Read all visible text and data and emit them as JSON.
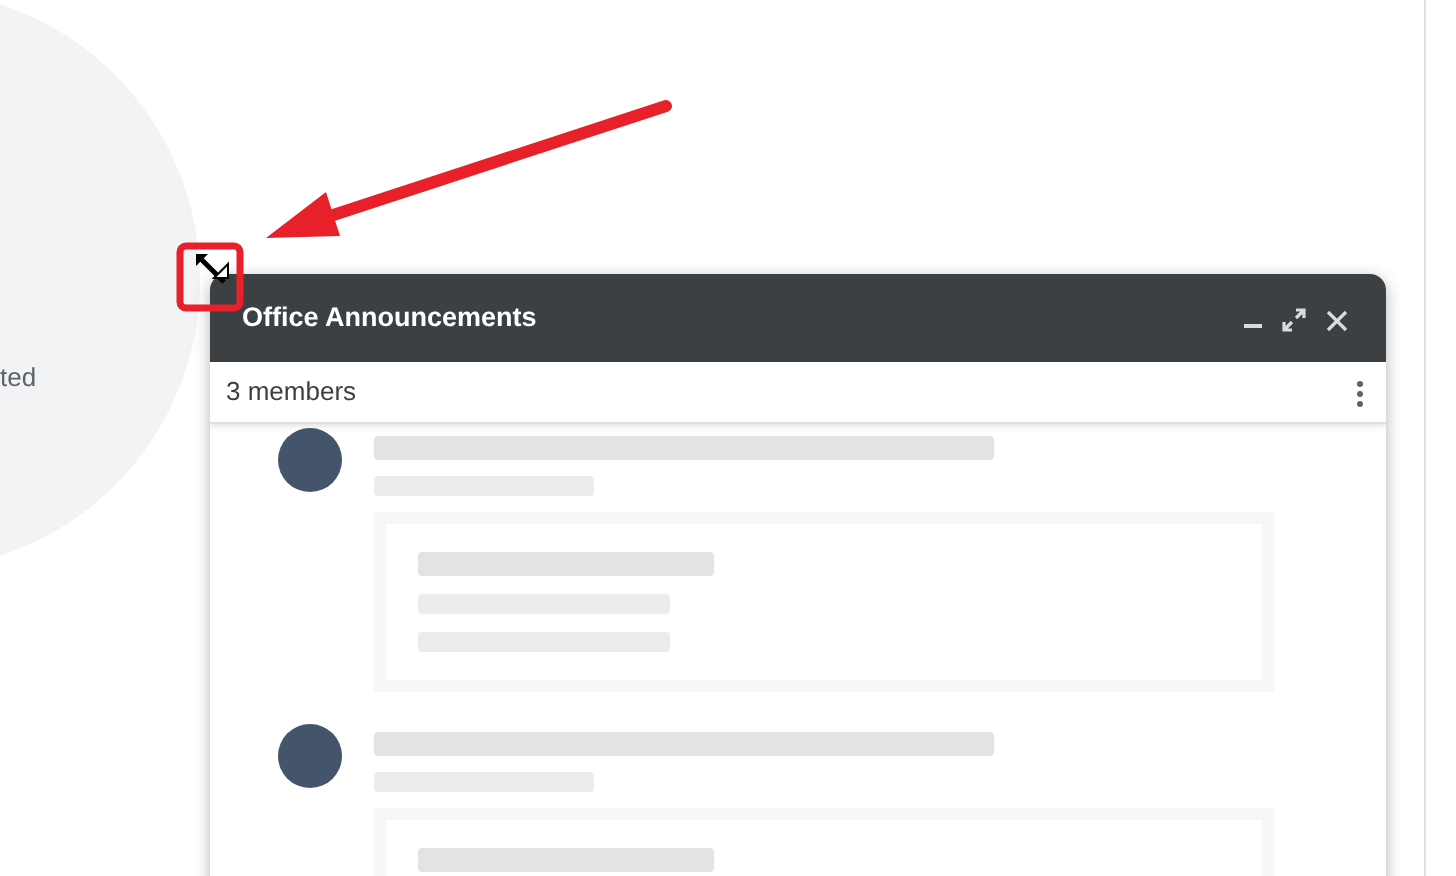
{
  "background": {
    "fragment_text": "ted"
  },
  "chat_window": {
    "title": "Office Announcements",
    "members": "3 members",
    "messages": [
      {
        "kind": "card"
      },
      {
        "kind": "card"
      }
    ]
  }
}
